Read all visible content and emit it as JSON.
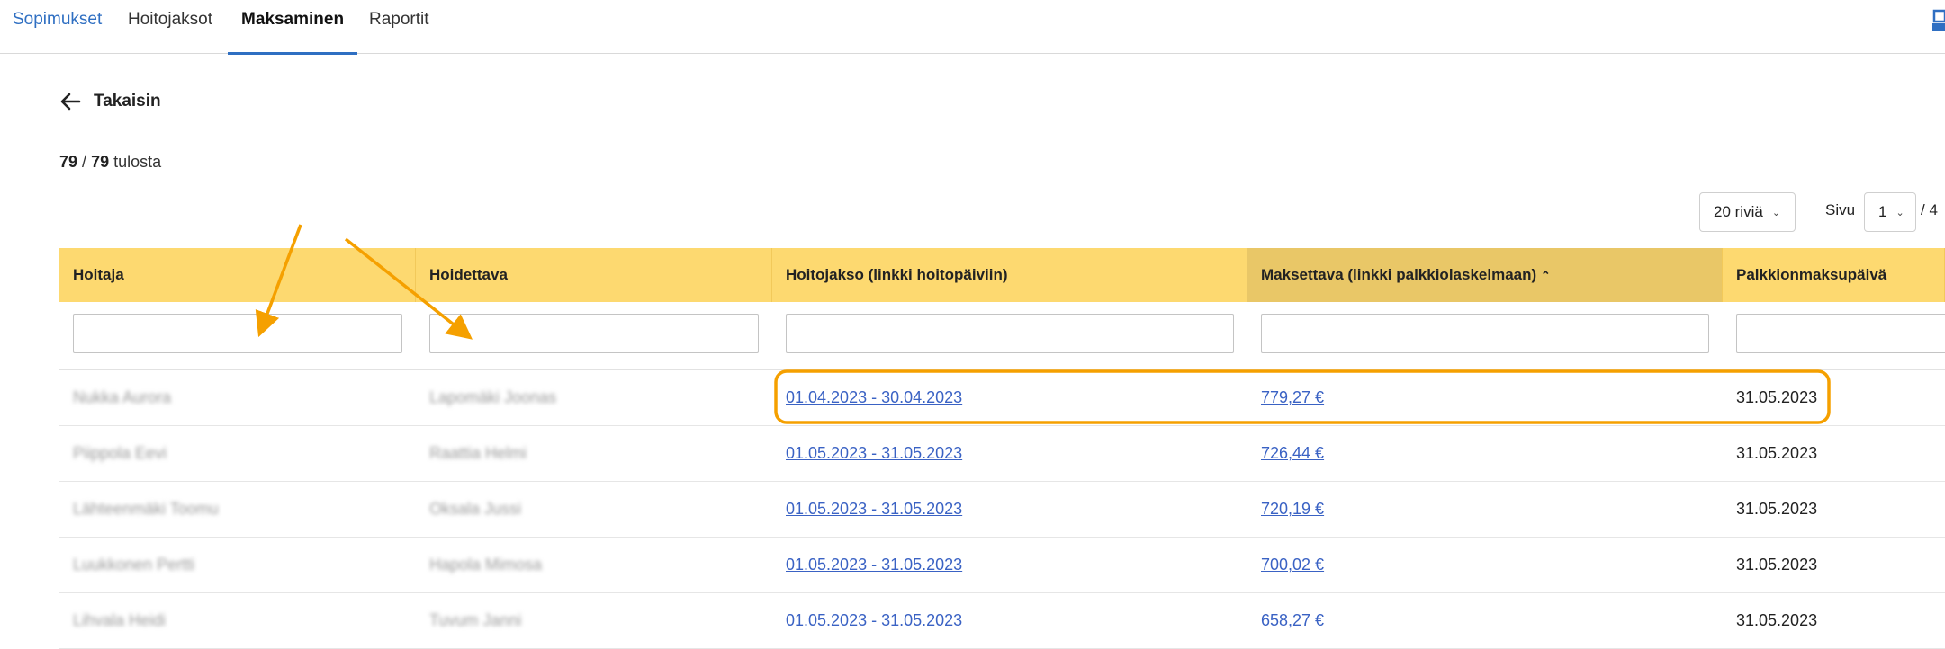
{
  "nav": {
    "tabs": [
      {
        "label": "Sopimukset"
      },
      {
        "label": "Hoitojaksot"
      },
      {
        "label": "Maksaminen"
      },
      {
        "label": "Raportit"
      }
    ],
    "active_tab": "Maksaminen"
  },
  "back": {
    "label": "Takaisin",
    "icon": "arrow-left-icon"
  },
  "results": {
    "shown": "79",
    "separator": "/",
    "total": "79",
    "suffix": "tulosta"
  },
  "pager": {
    "rows_per_page": "20 riviä",
    "page_label": "Sivu",
    "current_page": "1",
    "total_pages": "/ 4"
  },
  "table": {
    "columns": [
      "Hoitaja",
      "Hoidettava",
      "Hoitojakso (linkki hoitopäiviin)",
      "Maksettava (linkki palkkiolaskelmaan)",
      "Palkkionmaksupäivä"
    ],
    "sorted_column": "Maksettava (linkki palkkiolaskelmaan)",
    "sort_direction": "ascending-indicator",
    "rows": [
      {
        "hoitaja": "Nukka Aurora",
        "hoidettava": "Lapomäki Joonas",
        "jakso": "01.04.2023 - 30.04.2023",
        "maksettava": "779,27 €",
        "paiva": "31.05.2023"
      },
      {
        "hoitaja": "Piippola Eevi",
        "hoidettava": "Raattia Helmi",
        "jakso": "01.05.2023 - 31.05.2023",
        "maksettava": "726,44 €",
        "paiva": "31.05.2023"
      },
      {
        "hoitaja": "Lähteenmäki Toomu",
        "hoidettava": "Oksala Jussi",
        "jakso": "01.05.2023 - 31.05.2023",
        "maksettava": "720,19 €",
        "paiva": "31.05.2023"
      },
      {
        "hoitaja": "Luukkonen Pertti",
        "hoidettava": "Hapola Mimosa",
        "jakso": "01.05.2023 - 31.05.2023",
        "maksettava": "700,02 €",
        "paiva": "31.05.2023"
      },
      {
        "hoitaja": "Lihvala Heidi",
        "hoidettava": "Tuvum Janni",
        "jakso": "01.05.2023 - 31.05.2023",
        "maksettava": "658,27 €",
        "paiva": "31.05.2023"
      }
    ]
  },
  "colors": {
    "header_bg": "#fdd970",
    "sorted_header_bg": "#e9c767",
    "link": "#3a62c4",
    "annotation": "#f5a000"
  }
}
